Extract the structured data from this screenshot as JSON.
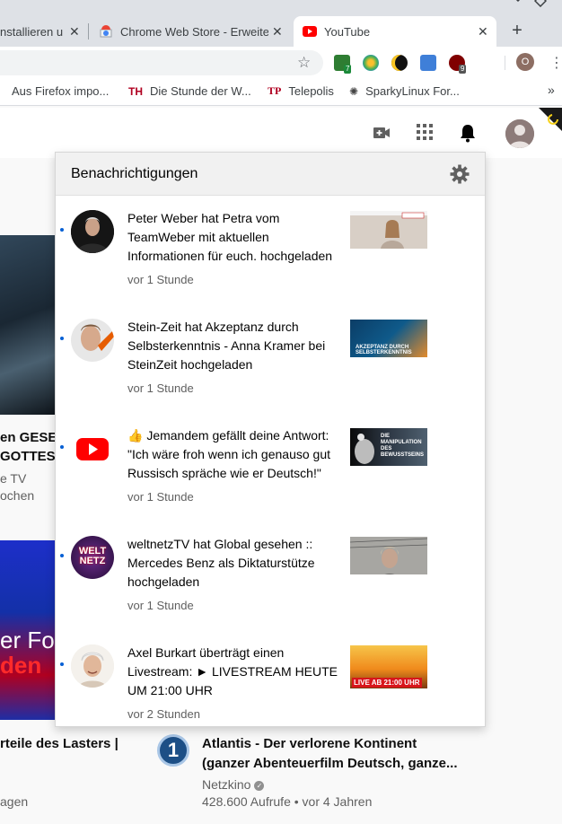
{
  "browser": {
    "tabs": [
      {
        "title": "nstallieren u",
        "active": false
      },
      {
        "title": "Chrome Web Store - Erweite",
        "active": false
      },
      {
        "title": "YouTube",
        "active": true
      }
    ],
    "new_tab": "+",
    "extension_badges": [
      "7",
      "9"
    ],
    "profile_initial": "O"
  },
  "bookmarks": {
    "items": [
      {
        "label": "Aus Firefox impo...",
        "icon": "folder-icon"
      },
      {
        "label": "Die Stunde der W...",
        "icon": "th-logo-icon"
      },
      {
        "label": "Telepolis",
        "icon": "tp-logo-icon"
      },
      {
        "label": "SparkyLinux For...",
        "icon": "sparky-icon"
      }
    ],
    "more": "»"
  },
  "notifications": {
    "title": "Benachrichtigungen",
    "items": [
      {
        "text": "Peter Weber hat Petra vom TeamWeber mit aktuellen Informationen für euch. hochgeladen",
        "time": "vor 1 Stunde",
        "avatar": "person-portrait",
        "thumb": "video-woman-room"
      },
      {
        "text": "Stein-Zeit hat Akzeptanz durch Selbsterkenntnis - Anna Kramer bei SteinZeit hochgeladen",
        "time": "vor 1 Stunde",
        "avatar": "stein-zeit-logo",
        "thumb": "akzeptanz-thumbnail",
        "thumb_text": "AKZEPTANZ DURCH SELBSTERKENNTNIS"
      },
      {
        "text": "👍 Jemandem gefällt deine Antwort: \"Ich wäre froh wenn ich genauso gut Russisch spräche wie er Deutsch!\"",
        "time": "vor 1 Stunde",
        "avatar": "youtube-logo",
        "thumb": "manipulation-thumbnail",
        "thumb_text": "DIE MANIPULATION DES BEWUSSTSEINS"
      },
      {
        "text": "weltnetzTV hat Global gesehen :: Mercedes Benz als Diktaturstütze hochgeladen",
        "time": "vor 1 Stunde",
        "avatar": "weltnetz-logo",
        "avatar_text": "WELT NETZ",
        "thumb": "woman-fence-thumbnail"
      },
      {
        "text": "Axel Burkart überträgt einen Livestream: ► LIVESTREAM HEUTE UM 21:00 UHR",
        "time": "vor 2 Stunden",
        "avatar": "person-portrait",
        "thumb": "sunset-thumbnail",
        "thumb_text": "LIVE AB 21:00 UHR"
      }
    ]
  },
  "background": {
    "card1_title_line1": "en GESET",
    "card1_title_line2": "GOTTES",
    "card1_channel": "e TV",
    "card1_meta": "ochen",
    "card2_thumb_line1": "er For",
    "card2_thumb_line2": "den",
    "card2_title": "rteile des Lasters |",
    "card2_meta": "agen",
    "card3_rank": "1",
    "card3_title_line1": "Atlantis - Der verlorene Kontinent",
    "card3_title_line2": "(ganzer Abenteuerfilm Deutsch, ganze...",
    "card3_channel": "Netzkino",
    "card3_meta": "428.600 Aufrufe • vor 4 Jahren"
  }
}
